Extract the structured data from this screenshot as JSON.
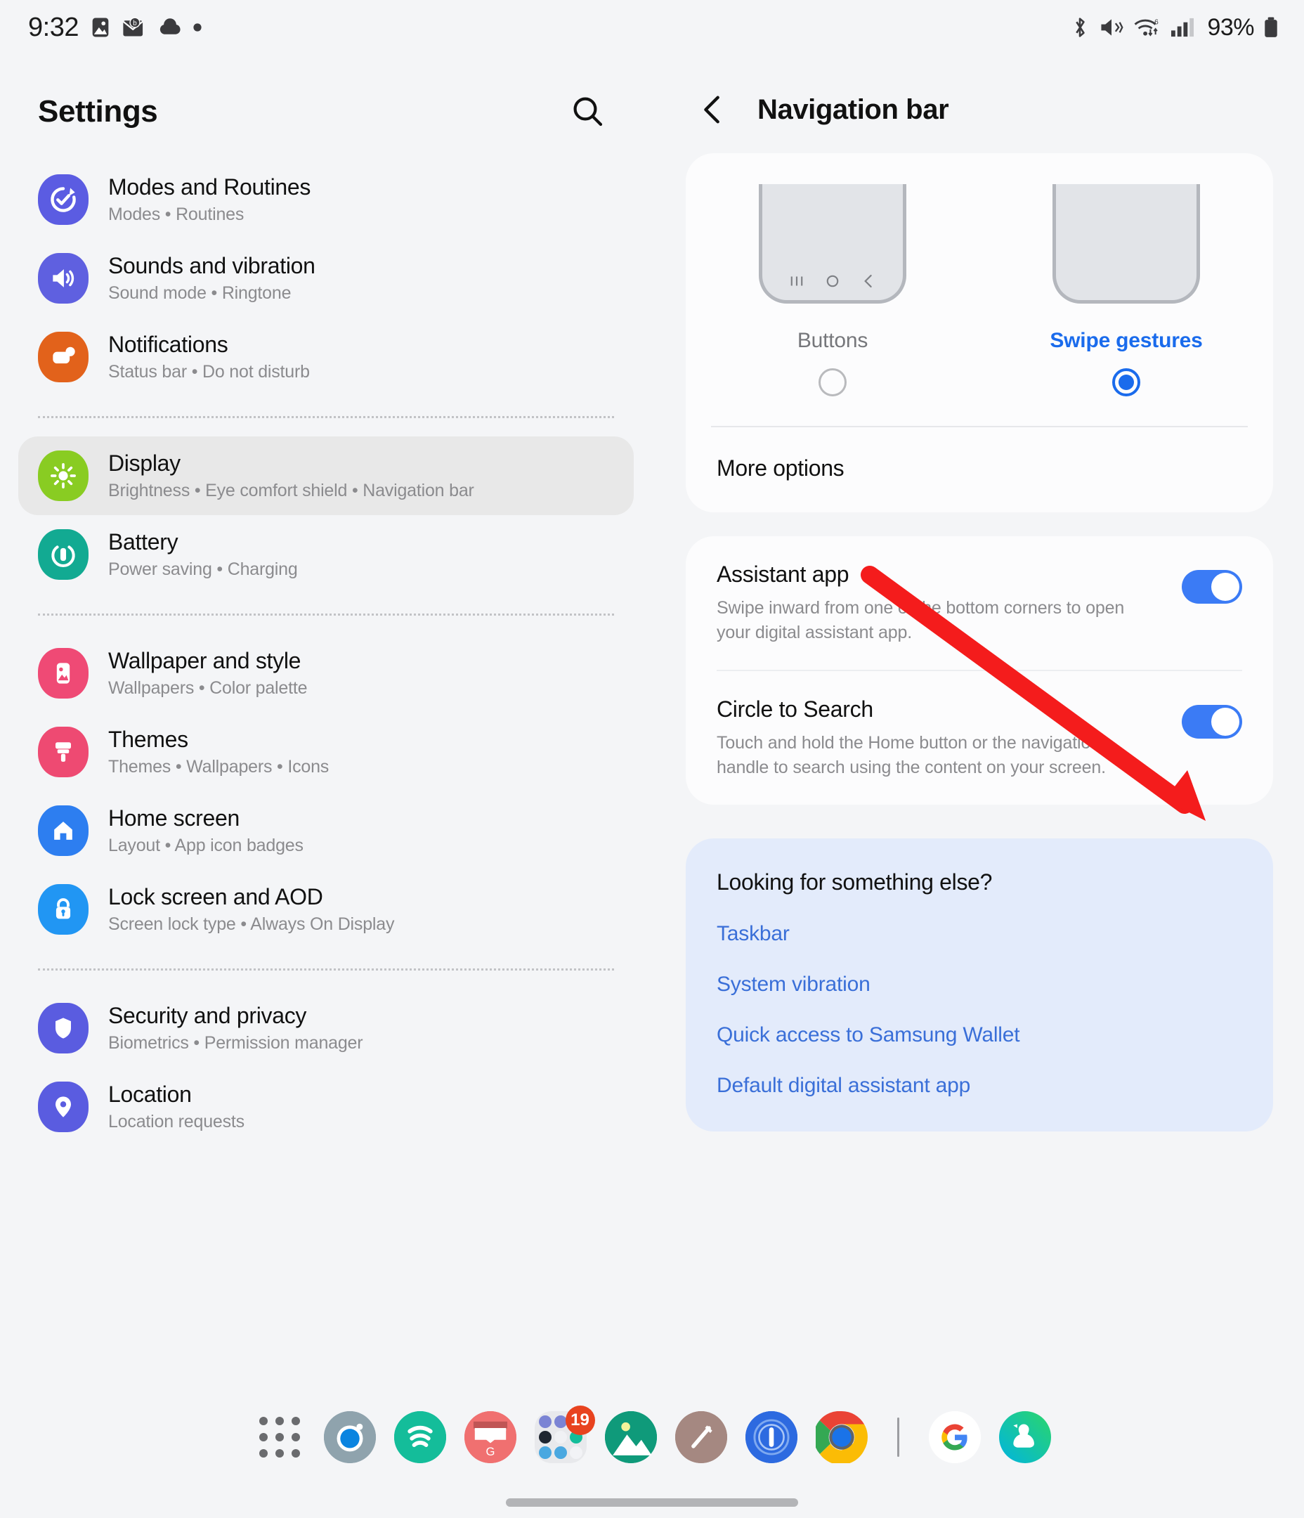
{
  "statusbar": {
    "time": "9:32",
    "left_icons": [
      "image-icon",
      "mail-icon",
      "cloud-icon",
      "dot-icon"
    ],
    "right_icons": [
      "bluetooth-icon",
      "mute-vibrate-icon",
      "wifi6-icon",
      "signal-icon"
    ],
    "battery_text": "93%"
  },
  "sidebar": {
    "title": "Settings",
    "search_icon": "search-icon",
    "items": [
      {
        "title": "Modes and Routines",
        "subtitle": "Modes  •  Routines",
        "icon": "modes-routines-icon",
        "color": "#5b5ce2",
        "selected": false
      },
      {
        "title": "Sounds and vibration",
        "subtitle": "Sound mode  •  Ringtone",
        "icon": "sound-icon",
        "color": "#5f60e0",
        "selected": false
      },
      {
        "title": "Notifications",
        "subtitle": "Status bar  •  Do not disturb",
        "icon": "notifications-icon",
        "color": "#e2621b",
        "selected": false
      },
      {
        "title": "Display",
        "subtitle": "Brightness  •  Eye comfort shield  •  Navigation bar",
        "icon": "display-icon",
        "color": "#89cc22",
        "selected": true
      },
      {
        "title": "Battery",
        "subtitle": "Power saving  •  Charging",
        "icon": "battery-icon",
        "color": "#12aa92",
        "selected": false
      },
      {
        "title": "Wallpaper and style",
        "subtitle": "Wallpapers  •  Color palette",
        "icon": "wallpaper-icon",
        "color": "#ef4a75",
        "selected": false
      },
      {
        "title": "Themes",
        "subtitle": "Themes  •  Wallpapers  •  Icons",
        "icon": "themes-icon",
        "color": "#ee4a72",
        "selected": false
      },
      {
        "title": "Home screen",
        "subtitle": "Layout  •  App icon badges",
        "icon": "home-screen-icon",
        "color": "#2d7ef0",
        "selected": false
      },
      {
        "title": "Lock screen and AOD",
        "subtitle": "Screen lock type  •  Always On Display",
        "icon": "lock-icon",
        "color": "#2196f3",
        "selected": false
      },
      {
        "title": "Security and privacy",
        "subtitle": "Biometrics  •  Permission manager",
        "icon": "shield-icon",
        "color": "#5a5ce0",
        "selected": false
      },
      {
        "title": "Location",
        "subtitle": "Location requests",
        "icon": "location-pin-icon",
        "color": "#5a5ce0",
        "selected": false
      }
    ],
    "separator_after": [
      2,
      4,
      8
    ]
  },
  "detail": {
    "back_icon": "back-chevron-icon",
    "title": "Navigation bar",
    "nav_type": {
      "options": [
        {
          "label": "Buttons",
          "selected": false,
          "preview": "buttons-phone-preview"
        },
        {
          "label": "Swipe gestures",
          "selected": true,
          "preview": "gestures-phone-preview"
        }
      ]
    },
    "more_options_label": "More options",
    "toggles": [
      {
        "title": "Assistant app",
        "description": "Swipe inward from one of the bottom corners to open your digital assistant app.",
        "state": "on"
      },
      {
        "title": "Circle to Search",
        "description": "Touch and hold the Home button or the navigation handle to search using the content on your screen.",
        "state": "on"
      }
    ],
    "looking_for": {
      "title": "Looking for something else?",
      "links": [
        "Taskbar",
        "System vibration",
        "Quick access to Samsung Wallet",
        "Default digital assistant app"
      ]
    }
  },
  "annotation": {
    "arrow_color": "#f41c1c",
    "arrow_points_to": "circle-to-search-toggle"
  },
  "dock": {
    "items": [
      {
        "name": "apps-grid-icon",
        "badge": null
      },
      {
        "name": "camera-icon",
        "badge": null
      },
      {
        "name": "spotify-icon",
        "badge": null
      },
      {
        "name": "gmail-icon",
        "badge": null
      },
      {
        "name": "app-folder-icon",
        "badge": "19"
      },
      {
        "name": "gallery-icon",
        "badge": null
      },
      {
        "name": "notes-pen-icon",
        "badge": null
      },
      {
        "name": "onepassword-icon",
        "badge": null
      },
      {
        "name": "chrome-icon",
        "badge": null
      },
      {
        "name": "divider",
        "badge": null
      },
      {
        "name": "google-icon",
        "badge": null
      },
      {
        "name": "duolingo-icon",
        "badge": null
      }
    ]
  },
  "colors": {
    "accent_blue": "#3b7bf5",
    "link_blue": "#3a6fd8",
    "selected_blue": "#1a6bec",
    "page_bg": "#f4f5f7",
    "card_bg": "#fcfcfd",
    "info_bg": "#e3ebfb"
  }
}
